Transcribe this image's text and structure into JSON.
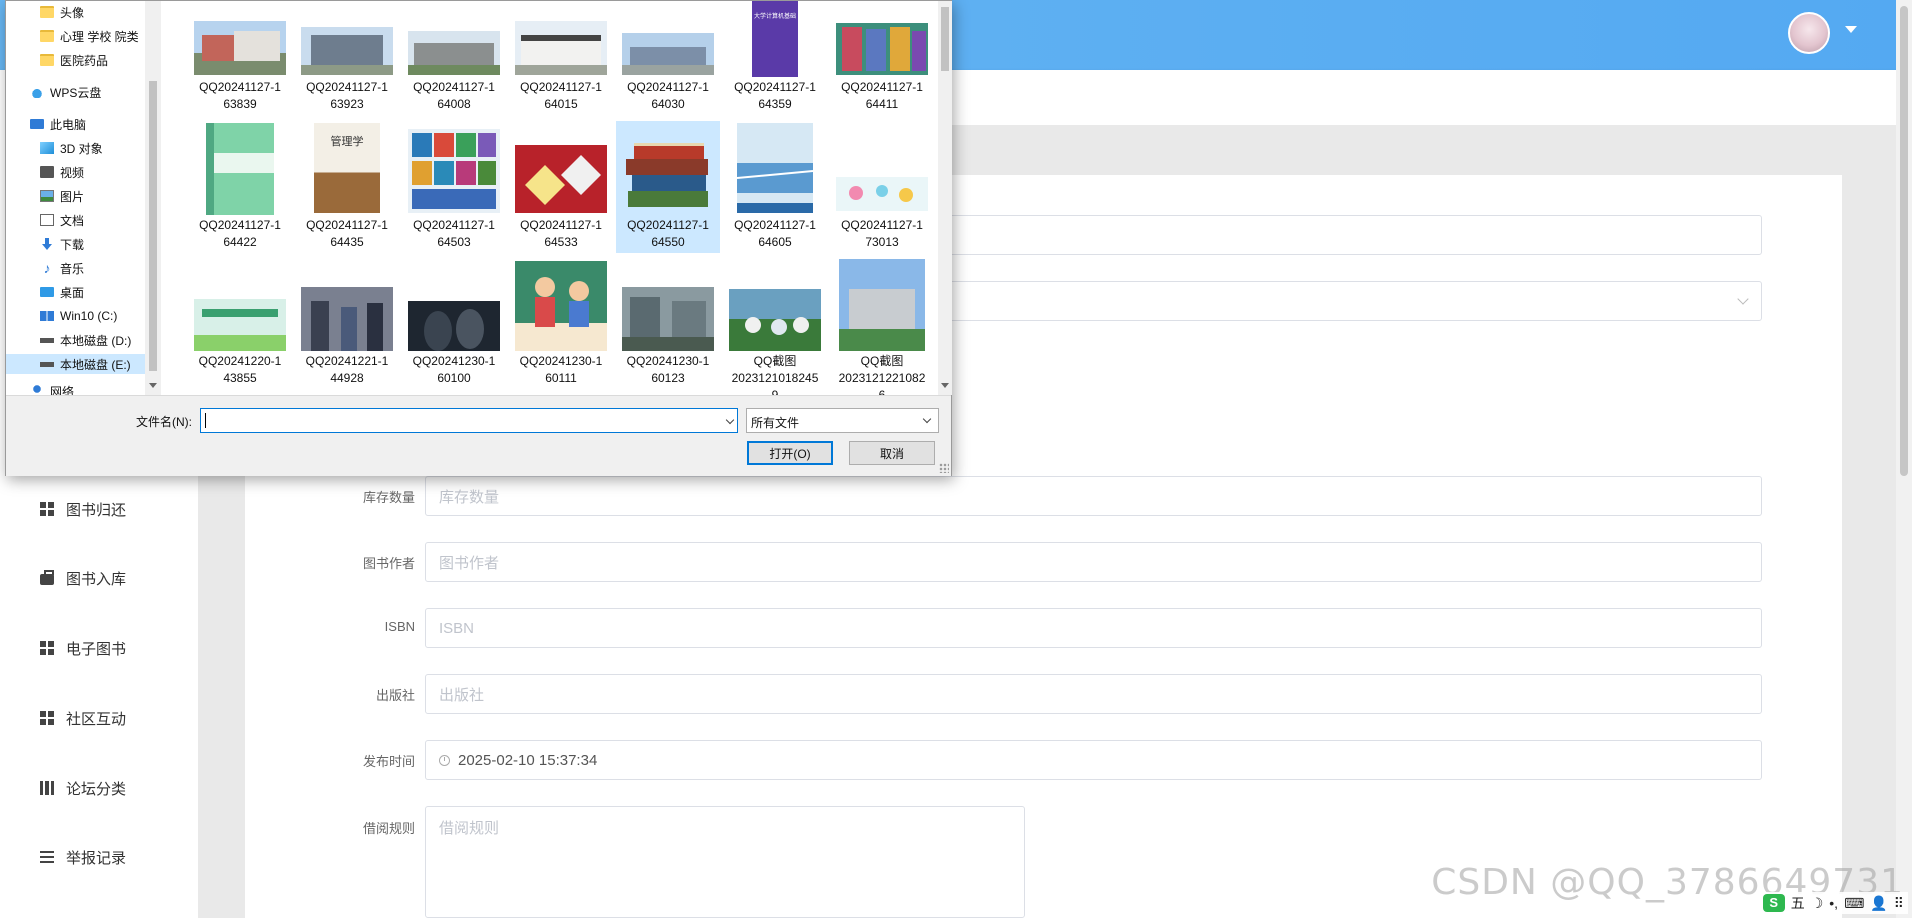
{
  "app": {
    "sidebar": {
      "items": [
        {
          "label": "图书归还",
          "icon": "grid-icon"
        },
        {
          "label": "图书入库",
          "icon": "briefcase-icon"
        },
        {
          "label": "电子图书",
          "icon": "grid-icon"
        },
        {
          "label": "社区互动",
          "icon": "grid-icon"
        },
        {
          "label": "论坛分类",
          "icon": "books-icon"
        },
        {
          "label": "举报记录",
          "icon": "list-icon"
        }
      ]
    },
    "form": {
      "stock_label": "库存数量",
      "stock_placeholder": "库存数量",
      "author_label": "图书作者",
      "author_placeholder": "图书作者",
      "isbn_label": "ISBN",
      "isbn_placeholder": "ISBN",
      "publisher_label": "出版社",
      "publisher_placeholder": "出版社",
      "publish_time_label": "发布时间",
      "publish_time_value": "2025-02-10 15:37:34",
      "rules_label": "借阅规则",
      "rules_placeholder": "借阅规则"
    },
    "watermark": "CSDN @QQ_3786649731",
    "ime": {
      "logo": "S",
      "mode": "五"
    }
  },
  "dialog": {
    "tree": [
      {
        "label": "头像",
        "icon": "folder-icon"
      },
      {
        "label": "心理 学校 院类",
        "icon": "folder-icon"
      },
      {
        "label": "医院药品",
        "icon": "folder-icon"
      },
      {
        "label": "WPS云盘",
        "icon": "cloud-icon"
      },
      {
        "label": "此电脑",
        "icon": "pc-icon"
      },
      {
        "label": "3D 对象",
        "icon": "3d-icon"
      },
      {
        "label": "视频",
        "icon": "video-icon"
      },
      {
        "label": "图片",
        "icon": "picture-icon"
      },
      {
        "label": "文档",
        "icon": "document-icon"
      },
      {
        "label": "下载",
        "icon": "download-icon"
      },
      {
        "label": "音乐",
        "icon": "music-icon"
      },
      {
        "label": "桌面",
        "icon": "desktop-icon"
      },
      {
        "label": "Win10 (C:)",
        "icon": "windows-drive-icon"
      },
      {
        "label": "本地磁盘 (D:)",
        "icon": "disk-icon"
      },
      {
        "label": "本地磁盘 (E:)",
        "icon": "disk-icon",
        "selected": true
      },
      {
        "label": "网络",
        "icon": "network-icon"
      }
    ],
    "files": [
      {
        "line1": "QQ20241127-1",
        "line2": "63839"
      },
      {
        "line1": "QQ20241127-1",
        "line2": "63923"
      },
      {
        "line1": "QQ20241127-1",
        "line2": "64008"
      },
      {
        "line1": "QQ20241127-1",
        "line2": "64015"
      },
      {
        "line1": "QQ20241127-1",
        "line2": "64030"
      },
      {
        "line1": "QQ20241127-1",
        "line2": "64359",
        "thumb_text": "大学计算机基础"
      },
      {
        "line1": "QQ20241127-1",
        "line2": "64411"
      },
      {
        "line1": "QQ20241127-1",
        "line2": "64422"
      },
      {
        "line1": "QQ20241127-1",
        "line2": "64435",
        "thumb_text": "管理学"
      },
      {
        "line1": "QQ20241127-1",
        "line2": "64503"
      },
      {
        "line1": "QQ20241127-1",
        "line2": "64533"
      },
      {
        "line1": "QQ20241127-1",
        "line2": "64550",
        "selected": true
      },
      {
        "line1": "QQ20241127-1",
        "line2": "64605"
      },
      {
        "line1": "QQ20241127-1",
        "line2": "73013"
      },
      {
        "line1": "QQ20241220-1",
        "line2": "43855"
      },
      {
        "line1": "QQ20241221-1",
        "line2": "44928"
      },
      {
        "line1": "QQ20241230-1",
        "line2": "60100"
      },
      {
        "line1": "QQ20241230-1",
        "line2": "60111"
      },
      {
        "line1": "QQ20241230-1",
        "line2": "60123"
      },
      {
        "line1": "QQ截图",
        "line2": "2023121018245",
        "line3": "9"
      },
      {
        "line1": "QQ截图",
        "line2": "2023121221082",
        "line3": "6"
      }
    ],
    "filename_label": "文件名(N):",
    "filename_value": "",
    "filter_value": "所有文件",
    "open_label": "打开(O)",
    "cancel_label": "取消"
  }
}
